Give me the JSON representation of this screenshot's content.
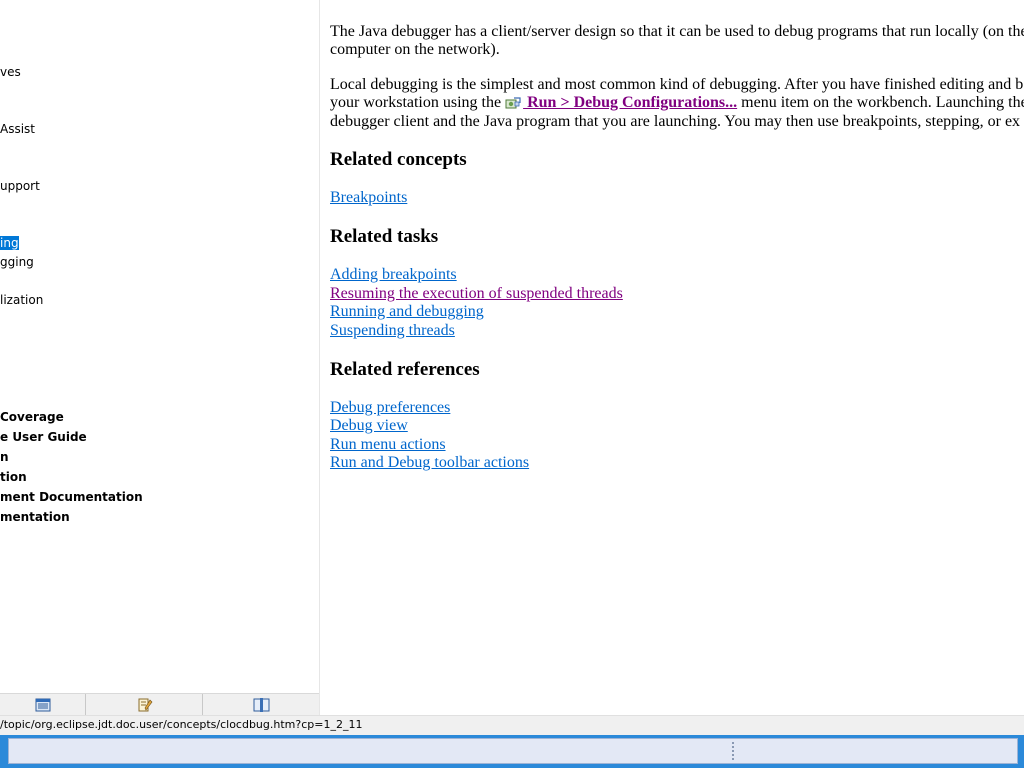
{
  "toc": {
    "items": [
      {
        "label": "ves",
        "bold": false,
        "selected": false
      },
      {
        "label": "Assist",
        "bold": false,
        "selected": false
      },
      {
        "label": "upport",
        "bold": false,
        "selected": false
      },
      {
        "label": "ing",
        "bold": false,
        "selected": true
      },
      {
        "label": "gging",
        "bold": false,
        "selected": false
      },
      {
        "label": "lization",
        "bold": false,
        "selected": false
      },
      {
        "label": " Coverage",
        "bold": true,
        "selected": false
      },
      {
        "label": "e User Guide",
        "bold": true,
        "selected": false
      },
      {
        "label": "n",
        "bold": true,
        "selected": false
      },
      {
        "label": "tion",
        "bold": true,
        "selected": false
      },
      {
        "label": "ment Documentation",
        "bold": true,
        "selected": false
      },
      {
        "label": "mentation",
        "bold": true,
        "selected": false
      }
    ],
    "tabs": [
      {
        "icon": "contents-icon"
      },
      {
        "icon": "index-icon"
      },
      {
        "icon": "bookmarks-icon"
      }
    ]
  },
  "content": {
    "intro_line1": "The Java debugger has a client/server design so that it can be used to debug programs that run locally (on the",
    "intro_line2": "computer on the network).",
    "local_line1": "Local debugging is the simplest and most common kind of debugging.  After you have finished editing and b",
    "local_line2_before": "your workstation using the ",
    "command_link": " Run > Debug Configurations...",
    "local_line2_after": " menu item on the workbench.  Launching the",
    "local_line3": "debugger client and the Java program that you are launching.  You may then use breakpoints, stepping, or ex",
    "related_concepts": {
      "heading": "Related concepts",
      "links": [
        "Breakpoints"
      ]
    },
    "related_tasks": {
      "heading": "Related tasks",
      "links": [
        "Adding breakpoints",
        "Resuming the execution of suspended threads",
        "Running and debugging",
        "Suspending threads"
      ]
    },
    "related_references": {
      "heading": "Related references",
      "links": [
        "Debug preferences",
        "Debug view",
        "Run menu actions",
        "Run and Debug toolbar actions"
      ]
    }
  },
  "status_bar": {
    "url_text": "/topic/org.eclipse.jdt.doc.user/concepts/clocdbug.htm?cp=1_2_11"
  },
  "colors": {
    "link": "#0066cc",
    "visited_link": "#800080",
    "selection": "#0078d7",
    "taskbar": "#2b89d9"
  }
}
